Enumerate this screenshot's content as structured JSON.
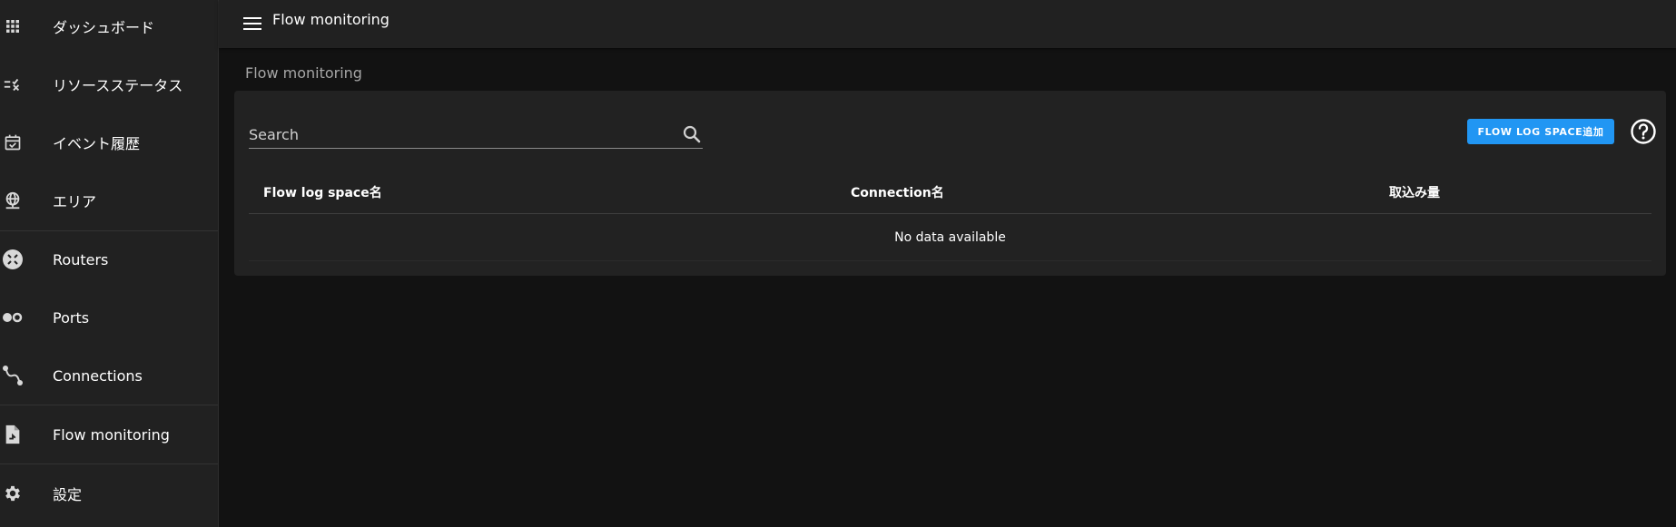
{
  "sidebar": {
    "items": [
      {
        "label": "ダッシュボード",
        "icon": "grid-icon"
      },
      {
        "label": "リソースステータス",
        "icon": "checklist-icon"
      },
      {
        "label": "イベント履歴",
        "icon": "calendar-check-icon"
      },
      {
        "label": "エリア",
        "icon": "globe-network-icon"
      },
      {
        "label": "Routers",
        "icon": "router-icon"
      },
      {
        "label": "Ports",
        "icon": "ports-icon"
      },
      {
        "label": "Connections",
        "icon": "connection-icon"
      },
      {
        "label": "Flow monitoring",
        "icon": "file-chart-icon"
      },
      {
        "label": "設定",
        "icon": "gear-icon"
      }
    ]
  },
  "header": {
    "title": "Flow monitoring"
  },
  "main": {
    "page_title": "Flow monitoring",
    "search": {
      "placeholder": "Search",
      "value": ""
    },
    "add_button_label": "FLOW LOG SPACE追加",
    "table": {
      "columns": [
        "Flow log space名",
        "Connection名",
        "取込み量"
      ],
      "empty_text": "No data available"
    }
  },
  "colors": {
    "accent": "#2196f3",
    "background": "#121212",
    "surface": "#222222",
    "sidebar": "#212121"
  }
}
